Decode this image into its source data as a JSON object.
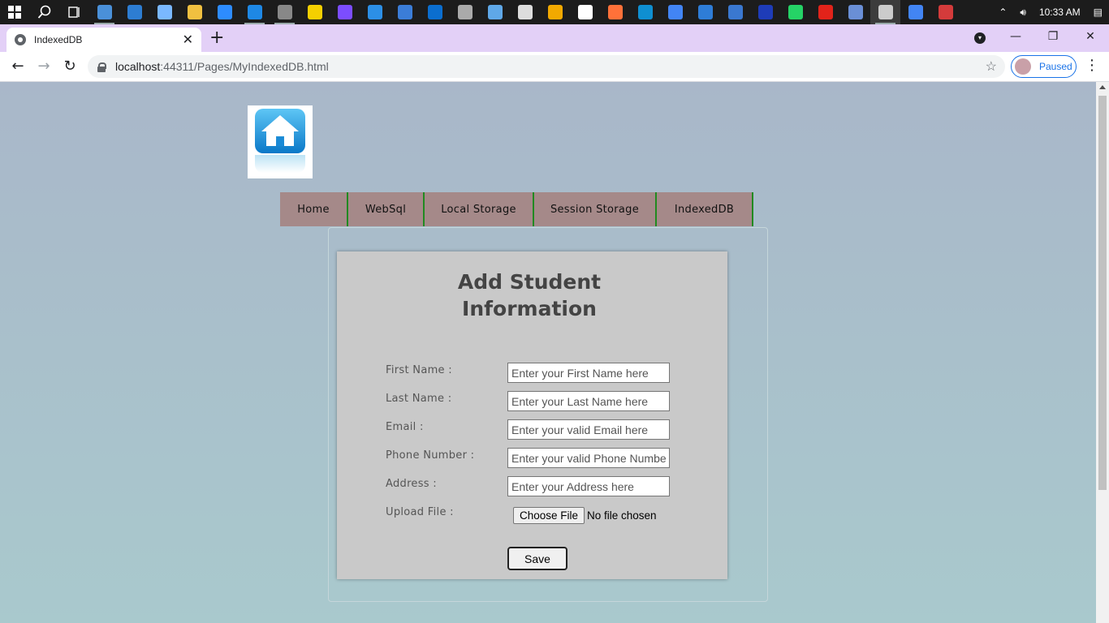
{
  "taskbar": {
    "clock": "10:33 AM",
    "icon_colors": [
      "#4a90d9",
      "#2d7dd2",
      "#7ab8ff",
      "#f0c040",
      "#2d8cff",
      "#1e88e5",
      "#888888",
      "#f5d000",
      "#7c4dff",
      "#2c8fe6",
      "#3b7dd8",
      "#0b6ecf",
      "#aaaaaa",
      "#5fa8e8",
      "#dddddd",
      "#f2a900",
      "#ffffff",
      "#ff7139",
      "#0f8fd1",
      "#4285f4",
      "#2e7dd7",
      "#3a78d0",
      "#1e3cb8",
      "#25d366",
      "#e2231a",
      "#6a8fd6",
      "#cccccc",
      "#4285f4",
      "#d43b3b"
    ]
  },
  "browser": {
    "tab_title": "IndexedDB",
    "tab_close": "✕",
    "new_tab": "+",
    "url_host": "localhost",
    "url_rest": ":44311/Pages/MyIndexedDB.html",
    "profile_status": "Paused"
  },
  "nav": {
    "items": [
      {
        "label": "Home"
      },
      {
        "label": "WebSql"
      },
      {
        "label": "Local Storage"
      },
      {
        "label": "Session Storage"
      },
      {
        "label": "IndexedDB"
      }
    ]
  },
  "form": {
    "title_line1": "Add Student",
    "title_line2": "Information",
    "first_name_label": "First Name :",
    "first_name_placeholder": "Enter your First Name here",
    "last_name_label": "Last Name :",
    "last_name_placeholder": "Enter your Last Name here",
    "email_label": "Email :",
    "email_placeholder": "Enter your valid Email here",
    "phone_label": "Phone Number :",
    "phone_placeholder": "Enter your valid Phone Number",
    "address_label": "Address :",
    "address_placeholder": "Enter your Address here",
    "upload_label": "Upload File :",
    "choose_file_label": "Choose File",
    "no_file_text": "No file chosen",
    "save_label": "Save"
  }
}
